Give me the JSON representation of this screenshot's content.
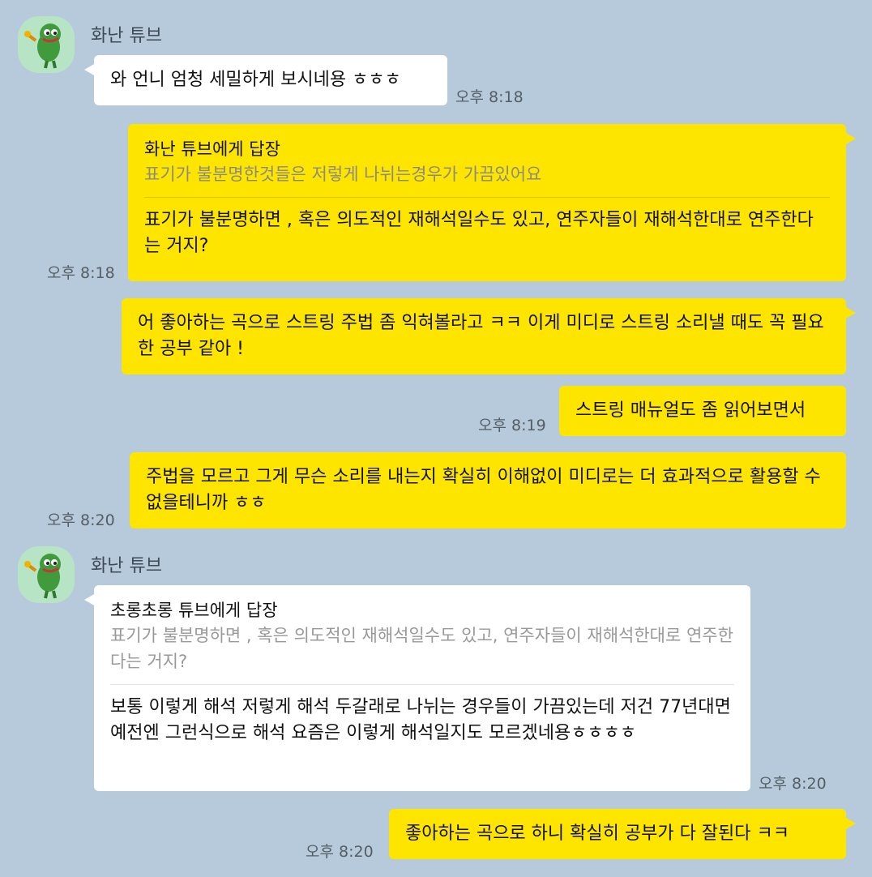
{
  "messages": [
    {
      "sender": "화난 튜브",
      "text": "와 언니 엄청 세밀하게 보시네용 ㅎㅎㅎ",
      "time": "오후 8:18"
    },
    {
      "reply_to": "화난 튜브에게 답장",
      "quote": "표기가 불분명한것들은 저렇게 나뉘는경우가 가끔있어요",
      "text": "표기가 불분명하면 , 혹은 의도적인 재해석일수도 있고, 연주자들이 재해석한대로 연주한다는 거지?",
      "time": "오후 8:18"
    },
    {
      "text": "어 좋아하는 곡으로 스트링 주법 좀 익혀볼라고 ㅋㅋ 이게 미디로 스트링 소리낼 때도 꼭 필요한 공부 같아 !"
    },
    {
      "text": "스트링 매뉴얼도 좀 읽어보면서",
      "time": "오후 8:19"
    },
    {
      "text": "주법을 모르고 그게 무슨 소리를 내는지 확실히 이해없이 미디로는 더 효과적으로 활용할 수 없을테니까 ㅎㅎ",
      "time": "오후 8:20"
    },
    {
      "sender": "화난 튜브",
      "reply_to": "초롱초롱 튜브에게 답장",
      "quote": "표기가 불분명하면 , 혹은 의도적인 재해석일수도 있고, 연주자들이 재해석한대로 연주한다는 거지?",
      "text": "보통 이렇게 해석 저렇게 해석 두갈래로 나뉘는 경우들이 가끔있는데 저건 77년대면 예전엔 그런식으로 해석 요즘은 이렇게 해석일지도 모르겠네용ㅎㅎㅎㅎ",
      "time": "오후 8:20"
    },
    {
      "text": "좋아하는 곡으로 하니 확실히 공부가 다 잘된다 ㅋㅋ",
      "time": "오후 8:20"
    }
  ],
  "icons": {
    "avatar": "angry-tube-duck-avatar"
  },
  "colors": {
    "background": "#b7cadb",
    "my_bubble": "#fee500",
    "other_bubble": "#ffffff"
  }
}
